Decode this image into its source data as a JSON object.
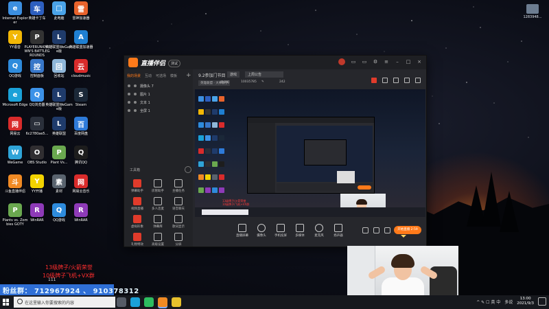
{
  "desktop": {
    "icons": [
      {
        "label": "Internet Explorer",
        "color": "#3c8fe0",
        "glyph": "e"
      },
      {
        "label": "英雄卡丁车",
        "color": "#2d5fbf",
        "glyph": "车"
      },
      {
        "label": "此电脑",
        "color": "#4aa3e8",
        "glyph": "□"
      },
      {
        "label": "雷神加速器",
        "color": "#e8632c",
        "glyph": "雷"
      },
      {
        "label": "YY语音",
        "color": "#f2b705",
        "glyph": "Y"
      },
      {
        "label": "PLAYERUNKNOWN'S BATTLEGROUNDS",
        "color": "#333333",
        "glyph": "P"
      },
      {
        "label": "英雄联盟WeGame版",
        "color": "#1f3b6b",
        "glyph": "L"
      },
      {
        "label": "英雄联盟加速器",
        "color": "#1f7fd1",
        "glyph": "A"
      },
      {
        "label": "QQ游戏",
        "color": "#2e8bdc",
        "glyph": "Q"
      },
      {
        "label": "控制面板",
        "color": "#3877c9",
        "glyph": "控"
      },
      {
        "label": "回收站",
        "color": "#8fb7d9",
        "glyph": "回"
      },
      {
        "label": "cloudmusic",
        "color": "#d92b2b",
        "glyph": "云"
      },
      {
        "label": "Microsoft Edge",
        "color": "#1aa1d8",
        "glyph": "e"
      },
      {
        "label": "QQ浏览器",
        "color": "#3c92e8",
        "glyph": "Q"
      },
      {
        "label": "英雄联盟WeGame版",
        "color": "#1f3b6b",
        "glyph": "L"
      },
      {
        "label": "Steam",
        "color": "#1b2838",
        "glyph": "S"
      },
      {
        "label": "网易云",
        "color": "#d92b2b",
        "glyph": "网"
      },
      {
        "label": "6c2780ae5...",
        "color": "#2a2f3a",
        "glyph": "▭"
      },
      {
        "label": "英雄联盟",
        "color": "#1f3b6b",
        "glyph": "L"
      },
      {
        "label": "百度网盘",
        "color": "#2e7ad8",
        "glyph": "百"
      },
      {
        "label": "WeGame",
        "color": "#2fa4d8",
        "glyph": "W"
      },
      {
        "label": "OBS Studio",
        "color": "#302e31",
        "glyph": "O"
      },
      {
        "label": "Plant Vs...",
        "color": "#6aa84f",
        "glyph": "P"
      },
      {
        "label": "腾讯QQ",
        "color": "#1d1d1d",
        "glyph": "Q"
      },
      {
        "label": "斗鱼直播伴侣",
        "color": "#f08a24",
        "glyph": "斗"
      },
      {
        "label": "YY开播",
        "color": "#f2d300",
        "glyph": "Y"
      },
      {
        "label": "素材",
        "color": "#59636e",
        "glyph": "素"
      },
      {
        "label": "网易云音乐",
        "color": "#d92b2b",
        "glyph": "网"
      },
      {
        "label": "Plants vs. Zombies GOTY",
        "color": "#6aa84f",
        "glyph": "P"
      },
      {
        "label": "WinRAR",
        "color": "#8e3ab8",
        "glyph": "R"
      },
      {
        "label": "QQ游戏",
        "color": "#2e8bdc",
        "glyph": "Q"
      },
      {
        "label": "WinRAR",
        "color": "#8e3ab8",
        "glyph": "R"
      },
      {
        "label": "111",
        "color": "#24262c",
        "glyph": "▭"
      }
    ],
    "top_right_item": "1283948..."
  },
  "app": {
    "title": "直播伴侣",
    "version_badge": "测试",
    "left_tabs": [
      "我的场景",
      "互动",
      "可选场",
      "模板"
    ],
    "scene_items": [
      "摄像头 7",
      "图片 1",
      "文本 1",
      "全屏 1"
    ],
    "tools_title": "工具箱",
    "tools": [
      "弹幕助手",
      "房管助手",
      "主播任务",
      "视频直播",
      "多人连麦",
      "语音聊天",
      "虚拟形象",
      "弹幕库",
      "歌词显示",
      "礼物特效",
      "高级设置",
      "分屏"
    ],
    "header": {
      "event": "9.2参加门节目",
      "tag": "游戏",
      "title_field": "上周公告",
      "category": "英雄联盟 · 大神教学",
      "room_label": "房间号",
      "room_id": "10035785",
      "hot_count": "242"
    },
    "bottom_controls": [
      "直播屏幕",
      "摄像头",
      "手机投屏",
      "多媒体",
      "麦克风",
      "扬声器"
    ],
    "go_live_label": "开始直播 2:59",
    "preview_red_1": "13级牌子/火箭荣誉",
    "preview_red_2": "10级牌子/飞机+VX群"
  },
  "overlay": {
    "promo_line_1": "13级牌子/火箭荣誉",
    "promo_line_2": "10级牌子飞机+VX群",
    "promo_line_3": "111",
    "fans_group": "粉丝群： 712967924 、 910378312"
  },
  "taskbar": {
    "search_placeholder": "在这里输入你要搜索的内容",
    "apps": [
      {
        "name": "task-view",
        "color": "#555b66"
      },
      {
        "name": "edge",
        "color": "#1aa1d8"
      },
      {
        "name": "wechat",
        "color": "#2dbe60"
      },
      {
        "name": "live-companion",
        "color": "#f08a24"
      },
      {
        "name": "chrome",
        "color": "#e8c12c"
      }
    ],
    "tray_text": "^ ✎ ☐ 英 中",
    "ime": "多说",
    "time": "13:00",
    "date": "2021/9/3"
  },
  "colors": {
    "accent": "#ff7a1a",
    "promo_red": "#ff2e2e",
    "fans_blue": "#2f6fd6"
  }
}
